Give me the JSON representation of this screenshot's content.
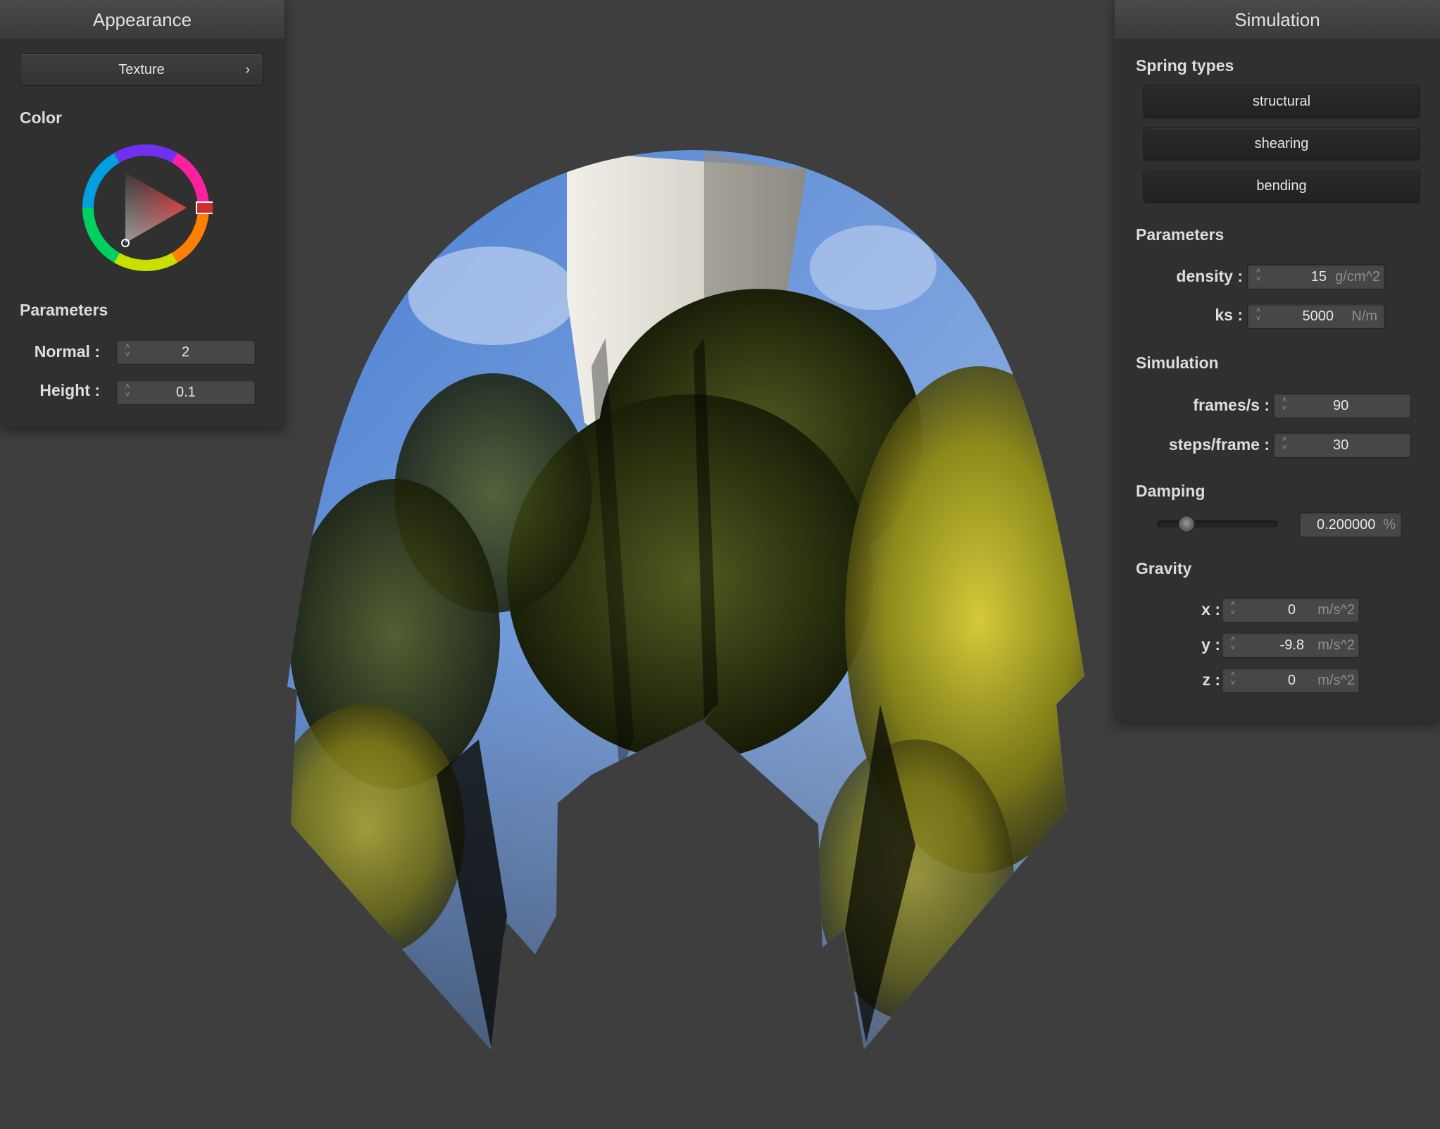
{
  "appearance": {
    "title": "Appearance",
    "texture_button": "Texture",
    "texture_chevron": "›",
    "color_label": "Color",
    "color_value": "#d42c2c",
    "parameters_label": "Parameters",
    "normal": {
      "label": "Normal :",
      "value": "2"
    },
    "height": {
      "label": "Height :",
      "value": "0.1"
    }
  },
  "simulation": {
    "title": "Simulation",
    "spring_types_label": "Spring types",
    "spring_buttons": [
      "structural",
      "shearing",
      "bending"
    ],
    "parameters_label": "Parameters",
    "density": {
      "label": "density :",
      "value": "15",
      "unit": "g/cm^2"
    },
    "ks": {
      "label": "ks :",
      "value": "5000",
      "unit": "N/m"
    },
    "simulation_label": "Simulation",
    "frames": {
      "label": "frames/s :",
      "value": "90"
    },
    "steps": {
      "label": "steps/frame :",
      "value": "30"
    },
    "damping_label": "Damping",
    "damping": {
      "value": "0.200000",
      "unit": "%",
      "slider_fraction": 0.2
    },
    "gravity_label": "Gravity",
    "gravity": [
      {
        "label": "x :",
        "value": "0",
        "unit": "m/s^2"
      },
      {
        "label": "y :",
        "value": "-9.8",
        "unit": "m/s^2"
      },
      {
        "label": "z :",
        "value": "0",
        "unit": "m/s^2"
      }
    ]
  },
  "colors": {
    "background": "#3e3e3e",
    "panel": "#303030",
    "cloth_sky": "#6f96d6",
    "cloth_foliage_dark": "#2d3512",
    "cloth_foliage_yellow": "#b4b42a",
    "cloth_building": "#d8d6cf"
  },
  "icons": {
    "spinner": "up-down-arrows-icon",
    "chevron": "chevron-right-icon"
  }
}
